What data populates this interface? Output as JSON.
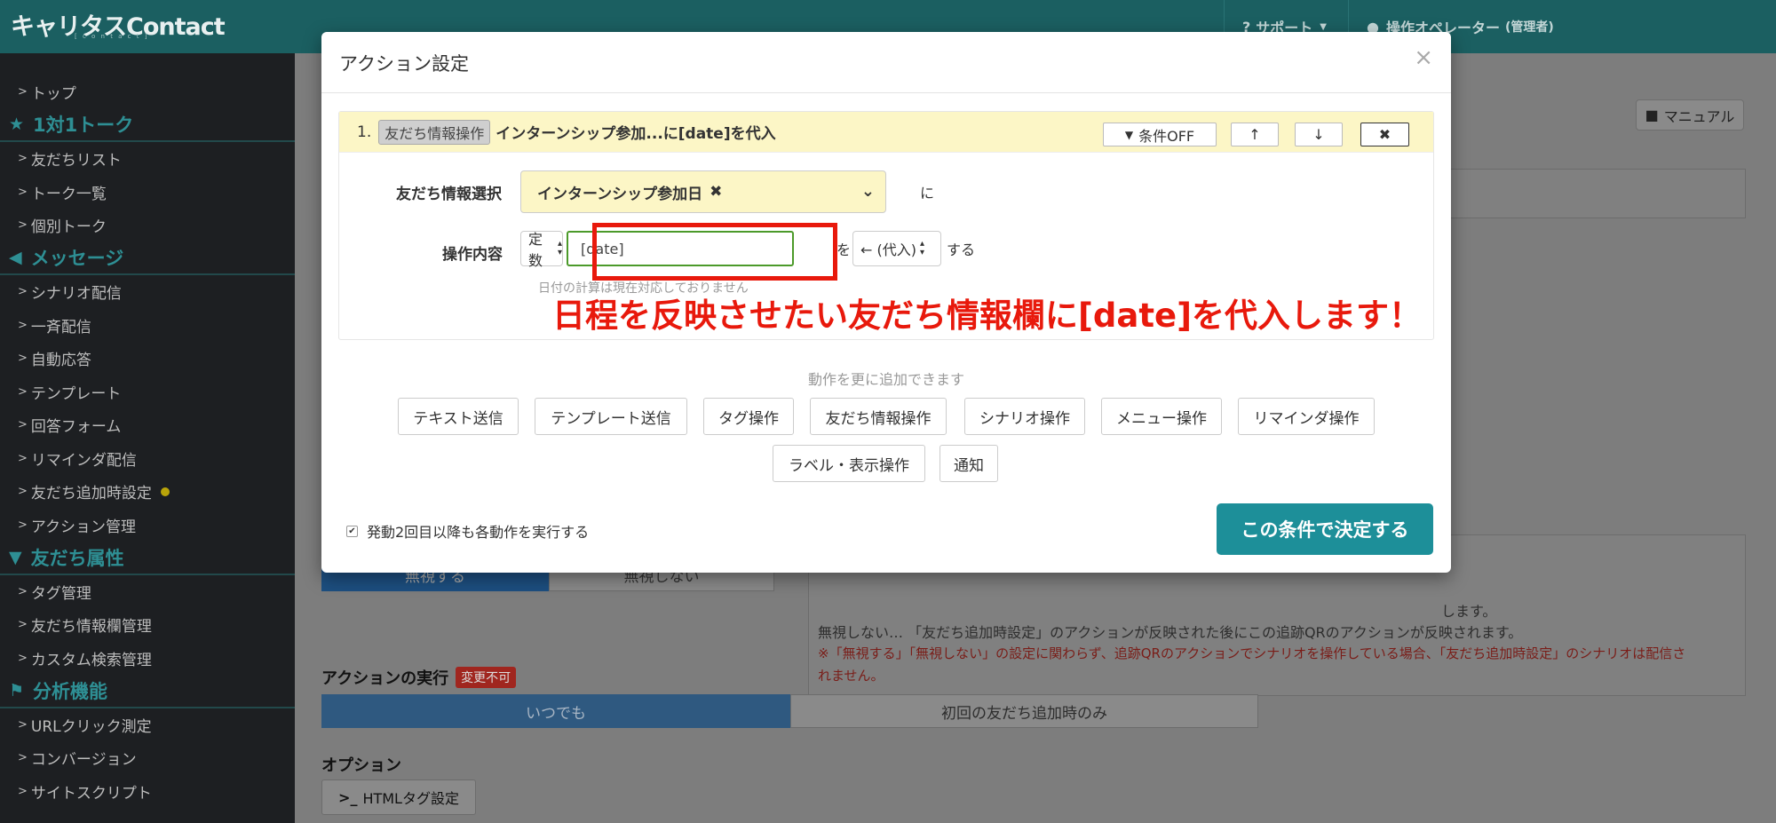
{
  "header": {
    "logo": "キャリタスContact",
    "logo_sub": "[ c o n t a c t ]",
    "support": "サポート",
    "operator": "操作オペレーター",
    "operator_role": "(管理者)"
  },
  "sidebar": {
    "top": "トップ",
    "sec_talk": "1対1トーク",
    "friend_list": "友だちリスト",
    "talk_list": "トーク一覧",
    "individual_talk": "個別トーク",
    "sec_message": "メッセージ",
    "scenario": "シナリオ配信",
    "broadcast": "一斉配信",
    "auto_reply": "自動応答",
    "template": "テンプレート",
    "answer_form": "回答フォーム",
    "reminder": "リマインダ配信",
    "friend_add_setting": "友だち追加時設定",
    "action_mgmt": "アクション管理",
    "sec_attr": "友だち属性",
    "tag_mgmt": "タグ管理",
    "friend_field_mgmt": "友だち情報欄管理",
    "custom_search": "カスタム検索管理",
    "sec_analysis": "分析機能",
    "url_click": "URLクリック測定",
    "conversion": "コンバージョン",
    "site_script": "サイトスクリプト"
  },
  "background": {
    "manual": "マニュアル",
    "line1": "します。",
    "line2": "無視しない… 「友だち追加時設定」のアクションが反映された後にこの追跡QRのアクションが反映されます。",
    "line3": "※「無視する」「無視しない」の設定に関わらず、追跡QRのアクションでシナリオを操作している場合、「友だち追加時設定」のシナリオは配信さ",
    "line4": "れません。",
    "ignore_yes": "無視する",
    "ignore_no": "無視しない",
    "exec_label": "アクションの実行",
    "exec_badge": "変更不可",
    "always": "いつでも",
    "first_only": "初回の友だち追加時のみ",
    "options": "オプション",
    "html_tag": "HTMLタグ設定"
  },
  "modal": {
    "title": "アクション設定",
    "close": "×",
    "panel_index": "1.",
    "panel_badge": "友だち情報操作",
    "panel_title": "インターンシップ参加...に[date]を代入",
    "cond_off": "条件OFF",
    "friend_label": "友だち情報選択",
    "friend_value": "インターンシップ参加日",
    "ni": "に",
    "op_label": "操作内容",
    "op_type": "定数",
    "op_value": "[date]",
    "wo": "を",
    "assign": "← (代入)",
    "suru": "する",
    "note": "日付の計算は現在対応しておりません",
    "annotation": "日程を反映させたい友だち情報欄に[date]を代入します！",
    "add_hint": "動作を更に追加できます",
    "actions": [
      "テキスト送信",
      "テンプレート送信",
      "タグ操作",
      "友だち情報操作",
      "シナリオ操作",
      "メニュー操作",
      "リマインダ操作",
      "ラベル・表示操作",
      "通知"
    ],
    "repeat_label": "発動2回目以降も各動作を実行する",
    "submit": "この条件で決定する"
  }
}
